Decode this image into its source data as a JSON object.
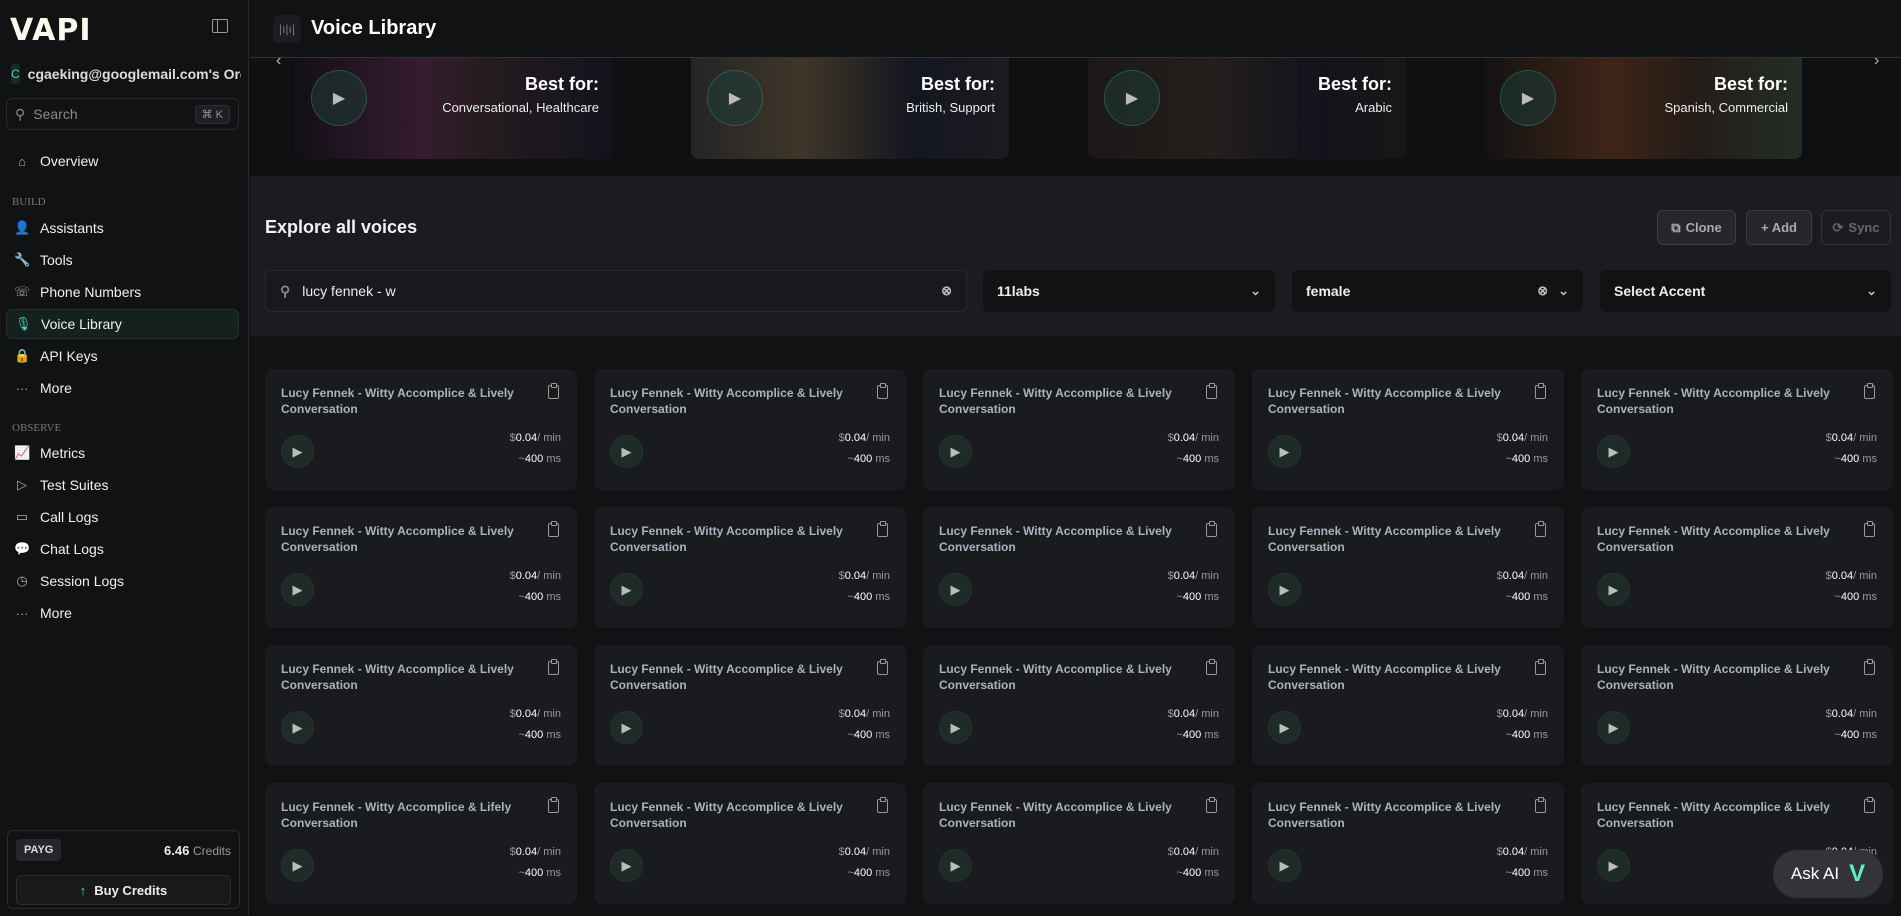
{
  "sidebar": {
    "logo": "VAPI",
    "org": "cgaeking@googlemail.com's Org",
    "org_initial": "C",
    "search_placeholder": "Search",
    "search_shortcut": "⌘ K",
    "overview": "Overview",
    "build_label": "BUILD",
    "build_items": [
      "Assistants",
      "Tools",
      "Phone Numbers",
      "Voice Library",
      "API Keys",
      "More"
    ],
    "observe_label": "OBSERVE",
    "observe_items": [
      "Metrics",
      "Test Suites",
      "Call Logs",
      "Chat Logs",
      "Session Logs",
      "More"
    ],
    "plan": "PAYG",
    "credits_value": "6.46",
    "credits_label": "Credits",
    "buy_credits": "Buy Credits"
  },
  "header": {
    "title": "Voice Library"
  },
  "featured": [
    {
      "heading": "Best for:",
      "tags": "Conversational, Healthcare"
    },
    {
      "heading": "Best for:",
      "tags": "British, Support"
    },
    {
      "heading": "Best for:",
      "tags": "Arabic"
    },
    {
      "heading": "Best for:",
      "tags": "Spanish, Commercial"
    }
  ],
  "explore": {
    "title": "Explore all voices",
    "clone": "Clone",
    "add": "+ Add",
    "sync": "Sync",
    "search_value": "lucy fennek - w",
    "provider": "11labs",
    "gender": "female",
    "accent_placeholder": "Select Accent"
  },
  "voices": [
    "Lucy Fennek - Witty Accomplice & Lively Conversation",
    "Lucy Fennek - Witty Accomplice & Lively Conversation",
    "Lucy Fennek - Witty Accomplice & Lively Conversation",
    "Lucy Fennek - Witty Accomplice & Lively Conversation",
    "Lucy Fennek - Witty Accomplice & Lively Conversation",
    "Lucy Fennek - Witty Accomplice & Lively Conversation",
    "Lucy Fennek - Witty Accomplice & Lively Conversation",
    "Lucy Fennek - Witty Accomplice & Lively Conversation",
    "Lucy Fennek - Witty Accomplice & Lively Conversation",
    "Lucy Fennek - Witty Accomplice & Lively Conversation",
    "Lucy Fennek - Witty Accomplice & Lively Conversation",
    "Lucy Fennek - Witty Accomplice & Lively Conversation",
    "Lucy Fennek - Witty Accomplice & Lively Conversation",
    "Lucy Fennek - Witty Accomplice & Lively Conversation",
    "Lucy Fennek - Witty Accomplice & Lively Conversation",
    "Lucy Fennek - Witty Accomplice & Lifely Conversation",
    "Lucy Fennek - Witty Accomplice & Lively Conversation",
    "Lucy Fennek - Witty Accomplice & Lively Conversation",
    "Lucy Fennek - Witty Accomplice & Lively Conversation",
    "Lucy Fennek - Witty Accomplice & Lively Conversation"
  ],
  "voice_price": {
    "currency": "$",
    "amount": "0.04",
    "unit": "/ min"
  },
  "voice_latency": {
    "prefix": "~",
    "value": "400",
    "unit": " ms"
  },
  "ask_ai": "Ask AI",
  "colors": {
    "accent": "#4fd1b5",
    "bg": "#111214",
    "panel": "#1b1c1f"
  }
}
